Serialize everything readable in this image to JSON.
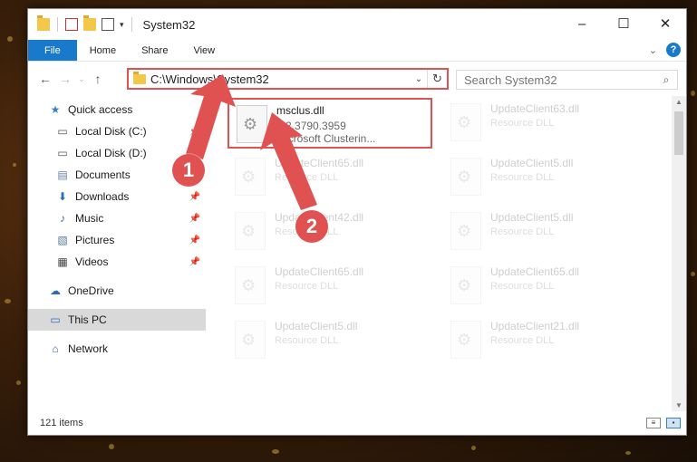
{
  "window": {
    "title": "System32"
  },
  "ribbon": {
    "tabs": [
      "File",
      "Home",
      "Share",
      "View"
    ],
    "help_label": "?"
  },
  "address": {
    "path": "C:\\Windows\\System32",
    "search_placeholder": "Search System32"
  },
  "sidebar": {
    "items": [
      {
        "label": "Quick access",
        "icon": "star-icon",
        "pinned": false
      },
      {
        "label": "Local Disk (C:)",
        "icon": "drive-icon",
        "pinned": true
      },
      {
        "label": "Local Disk (D:)",
        "icon": "drive-icon",
        "pinned": false
      },
      {
        "label": "Documents",
        "icon": "documents-icon",
        "pinned": true
      },
      {
        "label": "Downloads",
        "icon": "download-icon",
        "pinned": true
      },
      {
        "label": "Music",
        "icon": "music-icon",
        "pinned": true
      },
      {
        "label": "Pictures",
        "icon": "pictures-icon",
        "pinned": true
      },
      {
        "label": "Videos",
        "icon": "videos-icon",
        "pinned": true
      },
      {
        "label": "OneDrive",
        "icon": "cloud-icon",
        "pinned": false
      },
      {
        "label": "This PC",
        "icon": "computer-icon",
        "pinned": false
      },
      {
        "label": "Network",
        "icon": "network-icon",
        "pinned": false
      }
    ]
  },
  "files": [
    {
      "name": "msclus.dll",
      "line2": "5.2.3790.3959",
      "line3": "Microsoft Clusterin..."
    },
    {
      "name": "UpdateClient63.dll",
      "line2": "Resource DLL"
    },
    {
      "name": "UpdateClient65.dll",
      "line2": "Resource DLL"
    },
    {
      "name": "UpdateClient5.dll",
      "line2": "Resource DLL"
    },
    {
      "name": "UpdateClient42.dll",
      "line2": "Resource DLL"
    },
    {
      "name": "UpdateClient5.dll",
      "line2": "Resource DLL"
    },
    {
      "name": "UpdateClient65.dll",
      "line2": "Resource DLL"
    },
    {
      "name": "UpdateClient65.dll",
      "line2": "Resource DLL"
    },
    {
      "name": "UpdateClient5.dll",
      "line2": "Resource DLL"
    },
    {
      "name": "UpdateClient21.dll",
      "line2": "Resource DLL"
    }
  ],
  "status": {
    "item_count": "121 items"
  },
  "annotations": {
    "step1": "1",
    "step2": "2",
    "color": "#e05252"
  }
}
